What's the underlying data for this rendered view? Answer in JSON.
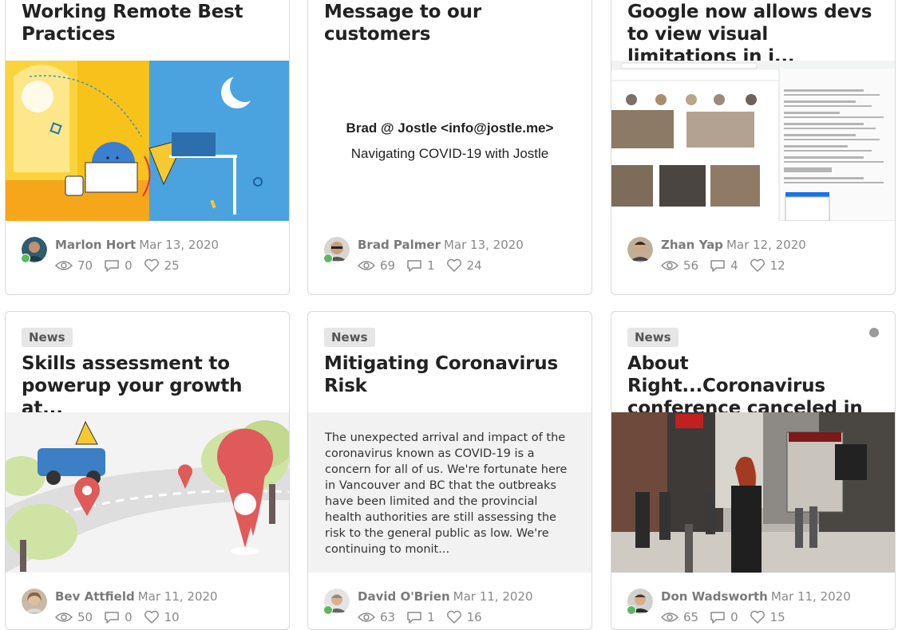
{
  "cards": [
    {
      "title": "Working Remote Best Practices",
      "author": "Marlon Hort",
      "date": "Mar 13, 2020",
      "views": "70",
      "comments": "0",
      "likes": "25"
    },
    {
      "title": "Message to our customers",
      "media_line1": "Brad @ Jostle <info@jostle.me>",
      "media_line2": "Navigating COVID-19 with Jostle",
      "author": "Brad Palmer",
      "date": "Mar 13, 2020",
      "views": "69",
      "comments": "1",
      "likes": "24"
    },
    {
      "title": "Google now allows devs to view visual limitations in i...",
      "author": "Zhan Yap",
      "date": "Mar 12, 2020",
      "views": "56",
      "comments": "4",
      "likes": "12"
    },
    {
      "badge": "News",
      "title": "Skills assessment to powerup your growth at...",
      "author": "Bev Attfield",
      "date": "Mar 11, 2020",
      "views": "50",
      "comments": "0",
      "likes": "10"
    },
    {
      "badge": "News",
      "title": "Mitigating Coronavirus Risk",
      "excerpt": "The unexpected arrival and impact of the coronavirus known as COVID-19 is a concern for all of us. We're fortunate here in Vancouver and BC that the outbreaks have been limited and the provincial health authorities are still assessing the risk to the general public as low. We're continuing to monit...",
      "author": "David O'Brien",
      "date": "Mar 11, 2020",
      "views": "63",
      "comments": "1",
      "likes": "16"
    },
    {
      "badge": "News",
      "title": "About Right...Coronavirus conference canceled in Ne...",
      "author": "Don Wadsworth",
      "date": "Mar 11, 2020",
      "views": "65",
      "comments": "0",
      "likes": "15"
    }
  ],
  "colors": {
    "online": "#5cb85c",
    "badge_bg": "#e6e6e6",
    "meta": "#8a8a8a"
  }
}
